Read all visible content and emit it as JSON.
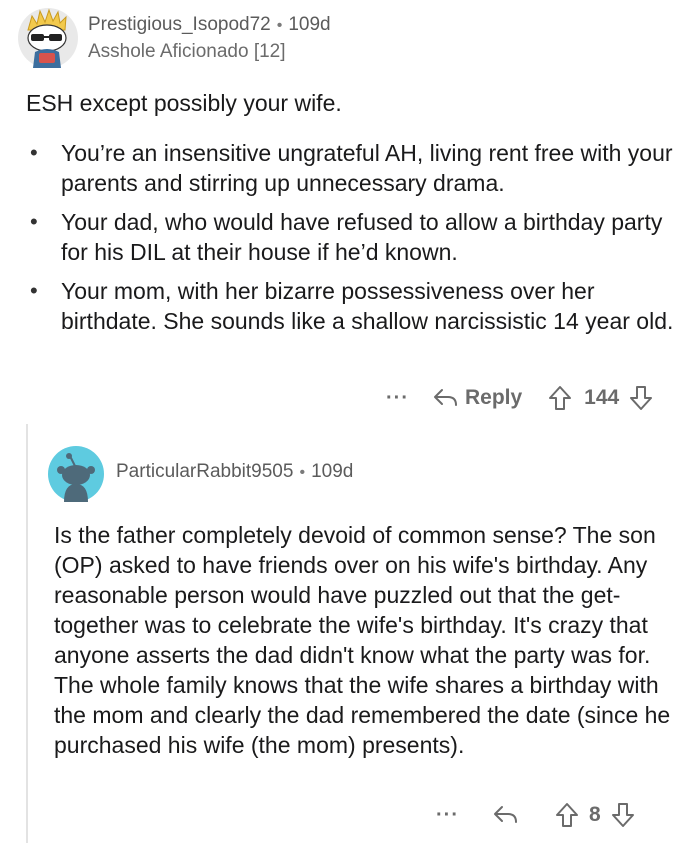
{
  "comment1": {
    "username": "Prestigious_Isopod72",
    "age": "109d",
    "flair": "Asshole Aficionado [12]",
    "intro": "ESH except possibly your wife.",
    "bullets": [
      "You’re an insensitive ungrateful AH, living rent free with your parents and stirring up unnecessary drama.",
      "Your dad, who would have refused to allow a birthday party for his DIL at their house if he’d known.",
      "Your mom, with her bizarre possessiveness over her birthdate. She sounds like a shallow narcissistic 14 year old."
    ],
    "actions": {
      "more": "···",
      "reply_label": "Reply",
      "score": "144"
    }
  },
  "comment2": {
    "username": "ParticularRabbit9505",
    "age": "109d",
    "body": "Is the father completely devoid of common sense? The son (OP) asked to have friends over on his wife's birthday. Any reasonable person would have puzzled out that the get-together was to celebrate the wife's birthday. It's crazy that anyone asserts the dad didn't know what the party was for. The whole family knows that the wife shares a birthday with the mom and clearly the dad remembered the date (since he purchased his wife (the mom) presents).",
    "actions": {
      "more": "···",
      "score": "8"
    }
  },
  "colors": {
    "avatar2_bg": "#5ecbe0",
    "snoo_body": "#4e6a7a",
    "text": "#1a1a1b",
    "meta": "#6b6b6b"
  }
}
